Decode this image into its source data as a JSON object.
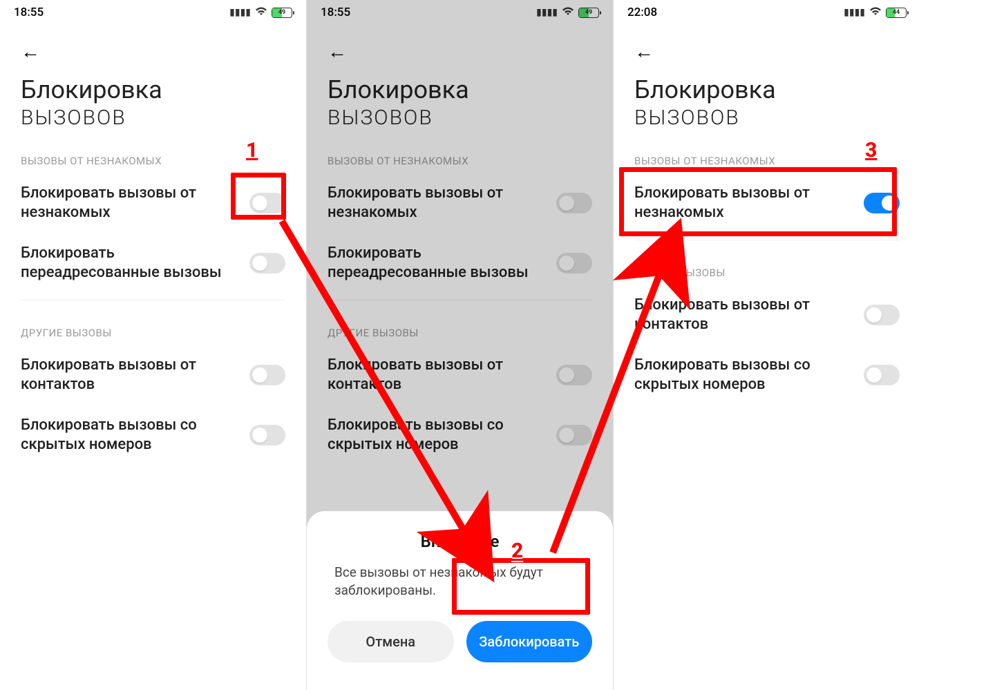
{
  "annotations": {
    "label1": "1",
    "label2": "2",
    "label3": "3",
    "colors": {
      "highlight": "#ff0000",
      "accent": "#0a84ff",
      "toggle_off": "#e2e2e2"
    }
  },
  "screen1": {
    "status": {
      "time": "18:55",
      "battery_pct": "49"
    },
    "title1": "Блокировка",
    "title2": "вызовов",
    "section_a": "ВЫЗОВЫ ОТ НЕЗНАКОМЫХ",
    "item1": "Блокировать вызовы от незнакомых",
    "item2": "Блокировать переадресованные вызовы",
    "section_b": "ДРУГИЕ ВЫЗОВЫ",
    "item3": "Блокировать вызовы от контактов",
    "item4": "Блокировать вызовы со скрытых номеров"
  },
  "screen2": {
    "status": {
      "time": "18:55",
      "battery_pct": "49"
    },
    "title1": "Блокировка",
    "title2": "вызовов",
    "section_a": "ВЫЗОВЫ ОТ НЕЗНАКОМЫХ",
    "item1": "Блокировать вызовы от незнакомых",
    "item2": "Блокировать переадресованные вызовы",
    "section_b": "ДРУГИЕ ВЫЗОВЫ",
    "item3": "Блокировать вызовы от контактов",
    "item4": "Блокировать вызовы со скрытых номеров",
    "dialog": {
      "title": "Внимание",
      "text": "Все вызовы от незнакомых будут заблокированы.",
      "cancel": "Отмена",
      "confirm": "Заблокировать"
    }
  },
  "screen3": {
    "status": {
      "time": "22:08",
      "battery_pct": "44"
    },
    "title1": "Блокировка",
    "title2": "вызовов",
    "section_a": "ВЫЗОВЫ ОТ НЕЗНАКОМЫХ",
    "item1": "Блокировать вызовы от незнакомых",
    "section_b": "ДРУГИЕ ВЫЗОВЫ",
    "item3": "Блокировать вызовы от контактов",
    "item4": "Блокировать вызовы со скрытых номеров"
  }
}
